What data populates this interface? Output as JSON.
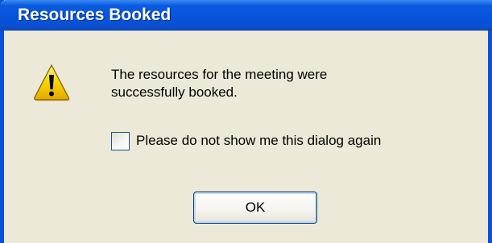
{
  "window": {
    "title": "Resources Booked"
  },
  "icon": {
    "name": "warning-icon",
    "color": "#f3c200"
  },
  "message": {
    "line1": "The resources for the meeting were",
    "line2": "successfully booked."
  },
  "checkbox": {
    "label": "Please do not show me this dialog again",
    "checked": false
  },
  "buttons": {
    "ok_label": "OK"
  },
  "colors": {
    "titlebar": "#0654dc",
    "frame": "#0a50d8",
    "body": "#ece9d8"
  }
}
